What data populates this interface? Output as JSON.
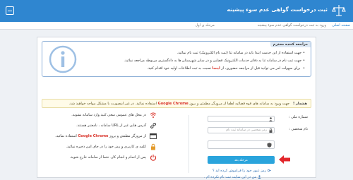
{
  "header": {
    "title": "ثبت درخواست گواهی عدم سوء پیشینه",
    "brand_color": "#2f86d0"
  },
  "breadcrumb": {
    "home": "صفحه اصلی",
    "items": [
      "ورود به ثبت درخواست گواهی عدم سوء پیشینه",
      "مرحله ی اول"
    ]
  },
  "notice": {
    "heading": "مراجعه کننده محترم",
    "line1": "جهت استفاده از این خدمت ابتدا باید در سامانه ثنا (ثبت نام الکترونیک) ثبت نام نمائید.",
    "line2": "جهت ثبت نام در سامانه ثنا به دفاتر خدمات الکترونیک قضایی و در سایر شهرستان ها به دادگستری مربوطه مراجعه نمائید.",
    "line3_prefix": "برای سهولت امر می توانید قبل از مراجعه حضوری، از",
    "line3_link": "اینجا",
    "line3_suffix": "نسبت به ثبت اطلاعات اولیه خود اقدام کنید."
  },
  "warning": {
    "label": "هشدار !",
    "prefix": "جهت ورود به سامانه های قوه قضائیه لطفا از مرورگر مطمئن و بروز",
    "browser": "Google Chrome",
    "suffix": "استفاده نمائید. در غیر اینصورت با مشکل مواجه خواهید شد."
  },
  "form": {
    "national_code_label": "شماره ملی :",
    "username_label": "نام شخصی :",
    "password_placeholder": "رمز شخصی در سامانه ثبت نام",
    "captcha_placeholder": "",
    "submit_label": "مرحله بعد",
    "forgot_link": "رمز عبور خود را فراموش کرده اید ؟",
    "register_link": "من در این سایت ثبت نام نکرده ام ."
  },
  "tips": [
    {
      "icon": "wifi-icon",
      "text": "در محل های عمومی سعی کنید وارد سامانه نشوید."
    },
    {
      "icon": "url-icon",
      "text": "آدرس هایی غیر از URL سامانه ، نامعتبر هستند."
    },
    {
      "icon": "browser-icon",
      "prefix": "از مرورگر مطمئن و بروز",
      "highlight": "Google Chrome",
      "suffix": "استفاده نمائید."
    },
    {
      "icon": "lock-icon",
      "text": "کلمه ی کاربری و رمز خود را در جای امن ذخیره نمائید."
    },
    {
      "icon": "power-icon",
      "text": "پس از اتمام و انجام کار، حتما از سامانه خارج شوید."
    }
  ],
  "colors": {
    "accent": "#2f86d0",
    "button": "#2aa4dc",
    "alert": "#d9342b"
  }
}
